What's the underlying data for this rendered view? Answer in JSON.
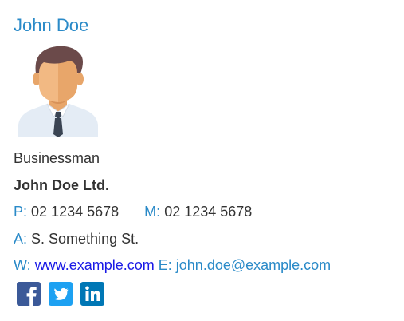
{
  "signature": {
    "name": "John Doe",
    "job_title": "Businessman",
    "company": "John Doe Ltd.",
    "phone": {
      "label": "P:",
      "value": "02 1234 5678"
    },
    "mobile": {
      "label": "M:",
      "value": "02 1234 5678"
    },
    "address": {
      "label": "A:",
      "value": "S. Something St."
    },
    "website": {
      "label": "W:",
      "value": "www.example.com"
    },
    "email": {
      "label": "E:",
      "value": "john.doe@example.com"
    }
  },
  "socials": [
    {
      "icon": "facebook-icon",
      "color": "#3b5998"
    },
    {
      "icon": "twitter-icon",
      "color": "#1da1f2"
    },
    {
      "icon": "linkedin-icon",
      "color": "#0077b5"
    }
  ],
  "colors": {
    "accent": "#2a8ac8",
    "text": "#333333",
    "web_link": "#1a1ae6"
  }
}
